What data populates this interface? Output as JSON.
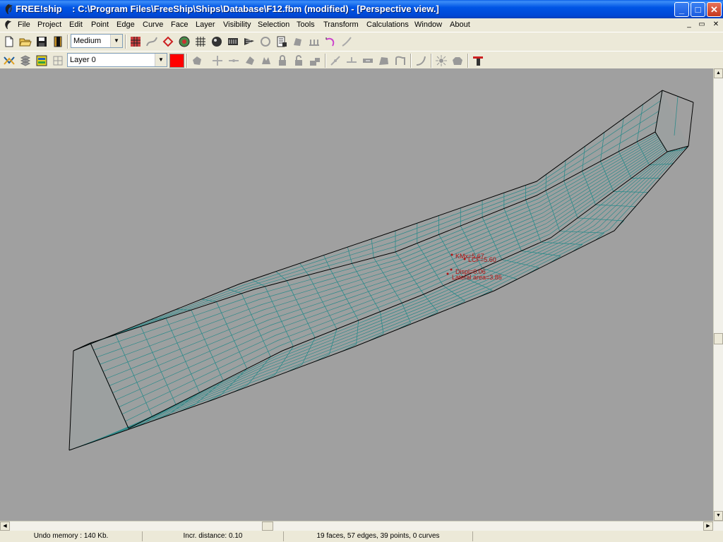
{
  "window": {
    "app_name": "FREE!ship",
    "title": "FREE!ship    : C:\\Program Files\\FreeShip\\Ships\\Database\\F12.fbm (modified) - [Perspective view.]",
    "minimize": "_",
    "maximize": "□",
    "close": "✕"
  },
  "menu": {
    "items": [
      "File",
      "Project",
      "Edit",
      "Point",
      "Edge",
      "Curve",
      "Face",
      "Layer",
      "Visibility",
      "Selection",
      "Tools",
      "Transform",
      "Calculations",
      "Window",
      "About"
    ],
    "mdi_minimize": "_",
    "mdi_restore": "▭",
    "mdi_close": "✕"
  },
  "toolbar1": {
    "precision_value": "Medium",
    "dropdown_arrow": "▼"
  },
  "toolbar2": {
    "layer_value": "Layer 0",
    "dropdown_arrow": "▼",
    "layer_color": "#FF0000"
  },
  "viewport": {
    "background": "#A0A0A0",
    "hull_color": "#2E8A8A",
    "edge_color": "#000000",
    "marker_color": "#B01010",
    "markers": {
      "kmx": "KMx=5.67",
      "lcf": "LCF=5.60",
      "displ": "Displ=0.06",
      "lateral": "Lateral area=3.85"
    }
  },
  "scroll": {
    "up": "▲",
    "down": "▼",
    "left": "◀",
    "right": "▶"
  },
  "statusbar": {
    "undo": "Undo memory : 140 Kb.",
    "incr": "Incr. distance: 0.10",
    "stats": "19 faces, 57 edges, 39 points, 0 curves"
  }
}
